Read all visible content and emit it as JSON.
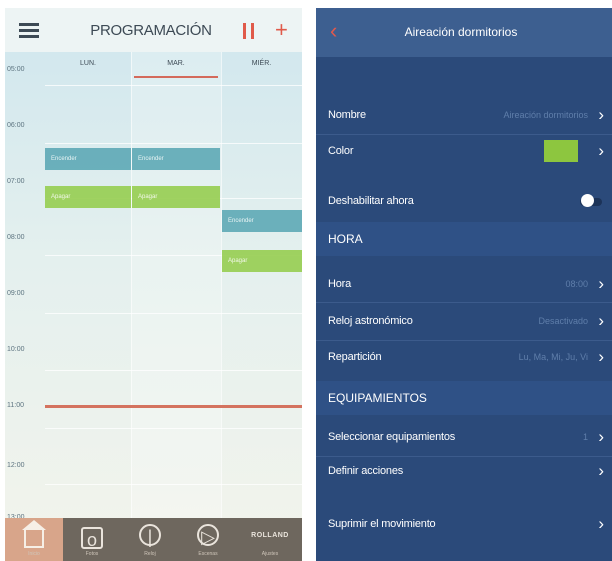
{
  "left": {
    "title": "PROGRAMACIÓN",
    "days": [
      "LUN.",
      "MAR.",
      "MIÉR."
    ],
    "times": [
      "05:00",
      "06:00",
      "07:00",
      "08:00",
      "09:00",
      "10:00",
      "11:00",
      "12:00",
      "13:00"
    ],
    "events": [
      "Encender",
      "Encender",
      "Apagar",
      "Apagar",
      "Encender",
      "Apagar"
    ],
    "tabs": [
      "Inicio",
      "Fotos",
      "Reloj",
      "Escenas",
      "Ajustes"
    ],
    "brand": "ROLLAND",
    "colors": {
      "accent": "#e05a4a",
      "event_teal": "#56a5b2",
      "event_green": "#96cd50",
      "tab_bar": "#6e675e"
    }
  },
  "right": {
    "title": "Aireación dormitorios",
    "rows": {
      "nombre": {
        "label": "Nombre",
        "value": "Aireación dormitorios"
      },
      "color": {
        "label": "Color",
        "swatch": "#8dc63f"
      },
      "deshabilitar": {
        "label": "Deshabilitar ahora"
      },
      "hora_section": "HORA",
      "hora": {
        "label": "Hora",
        "value": "08:00"
      },
      "reloj": {
        "label": "Reloj astronómico",
        "value": "Desactivado"
      },
      "reparticion": {
        "label": "Repartición",
        "value": "Lu, Ma, Mi, Ju, Vi"
      },
      "equip_section": "EQUIPAMIENTOS",
      "seleccionar": {
        "label": "Seleccionar equipamientos",
        "value": "1"
      },
      "definir": {
        "label": "Definir acciones"
      },
      "suprimir": {
        "label": "Suprimir el movimiento"
      }
    },
    "colors": {
      "background": "#2b4a7a",
      "header": "#3d5f90",
      "back": "#e0594c"
    }
  }
}
